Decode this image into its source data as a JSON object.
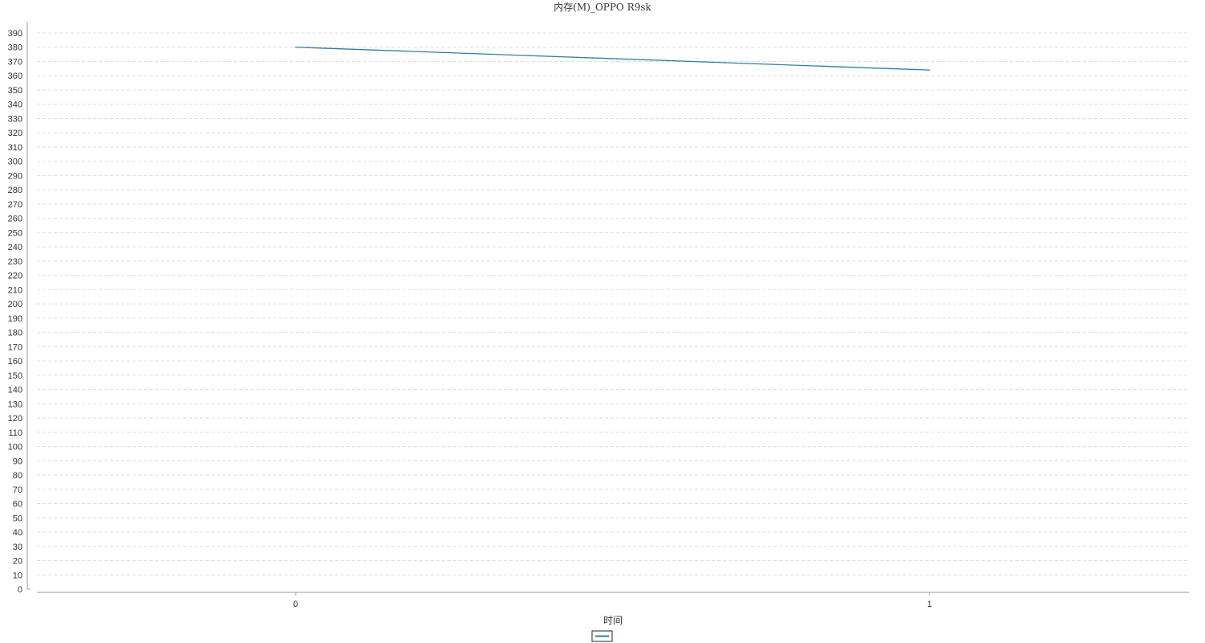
{
  "chart_data": {
    "type": "line",
    "title": "内存(M)_OPPO R9sk",
    "xlabel": "时间",
    "ylabel": "",
    "categories": [
      "0",
      "1"
    ],
    "series": [
      {
        "values": [
          380,
          364
        ],
        "color": "#2f7ea6"
      }
    ],
    "ylim": [
      0,
      390
    ],
    "ytick_step": 10,
    "grid": true,
    "legend_position": "bottom-center"
  }
}
